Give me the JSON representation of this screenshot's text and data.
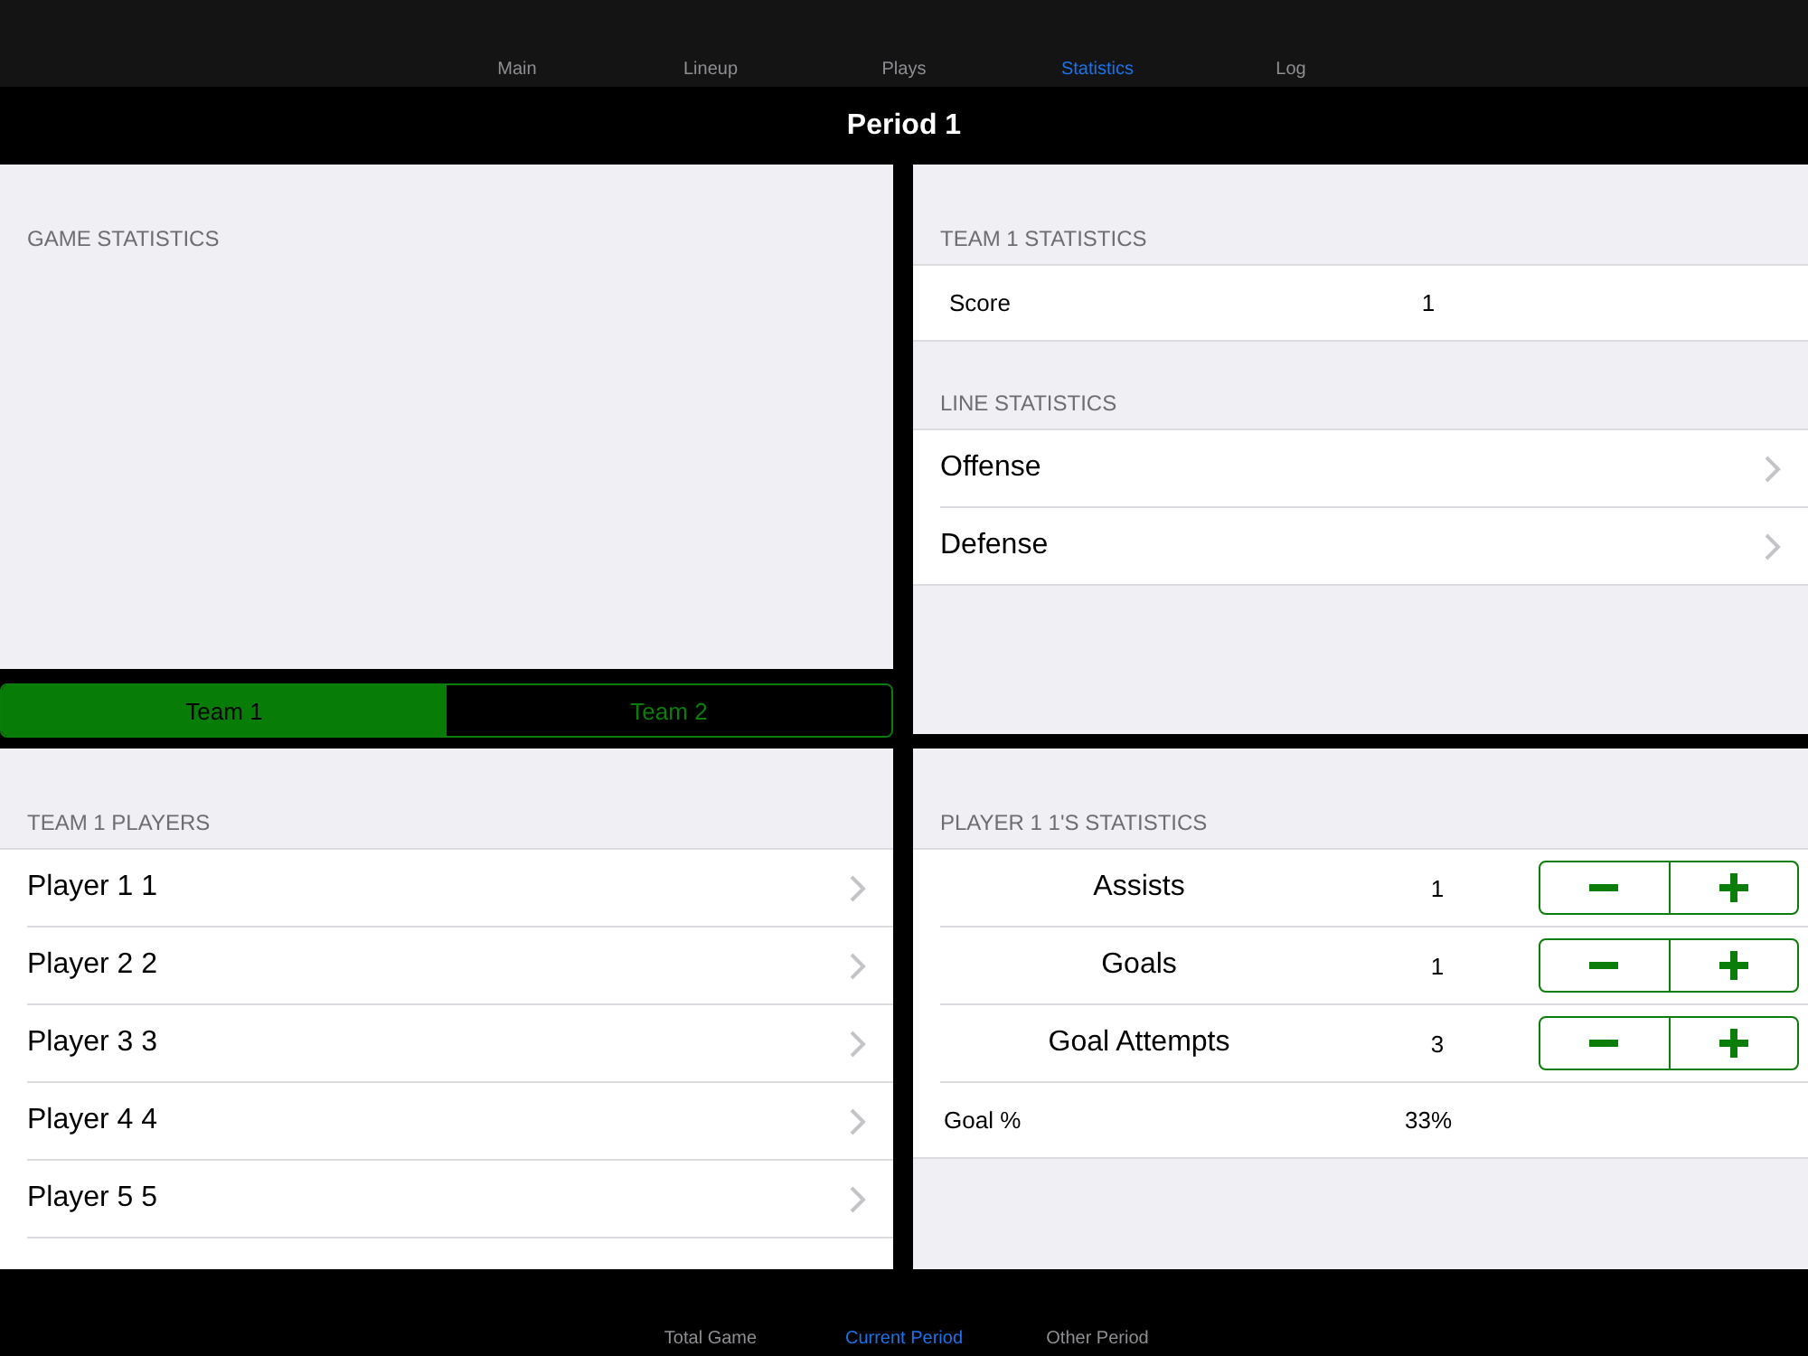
{
  "top_tabs": [
    {
      "label": "Main",
      "selected": false
    },
    {
      "label": "Lineup",
      "selected": false
    },
    {
      "label": "Plays",
      "selected": false
    },
    {
      "label": "Statistics",
      "selected": true
    },
    {
      "label": "Log",
      "selected": false
    }
  ],
  "title": "Period 1",
  "game_statistics": {
    "header": "GAME STATISTICS"
  },
  "team_segments": [
    {
      "label": "Team 1",
      "selected": true
    },
    {
      "label": "Team 2",
      "selected": false
    }
  ],
  "team_statistics": {
    "header": "TEAM 1 STATISTICS",
    "rows": [
      {
        "label": "Score",
        "value": "1"
      }
    ]
  },
  "line_statistics": {
    "header": "LINE STATISTICS",
    "items": [
      "Offense",
      "Defense"
    ]
  },
  "players": {
    "header": "TEAM 1 PLAYERS",
    "items": [
      "Player 1 1",
      "Player 2 2",
      "Player 3 3",
      "Player 4 4",
      "Player 5 5"
    ]
  },
  "player_statistics": {
    "header": "PLAYER 1 1'S STATISTICS",
    "rows": [
      {
        "kind": "stepper",
        "label": "Assists",
        "value": "1"
      },
      {
        "kind": "stepper",
        "label": "Goals",
        "value": "1"
      },
      {
        "kind": "stepper",
        "label": "Goal Attempts",
        "value": "3"
      },
      {
        "kind": "plain",
        "label": "Goal %",
        "value": "33%"
      }
    ]
  },
  "bottom_tabs": [
    {
      "label": "Total Game",
      "selected": false
    },
    {
      "label": "Current Period",
      "selected": true
    },
    {
      "label": "Other Period",
      "selected": false
    }
  ]
}
